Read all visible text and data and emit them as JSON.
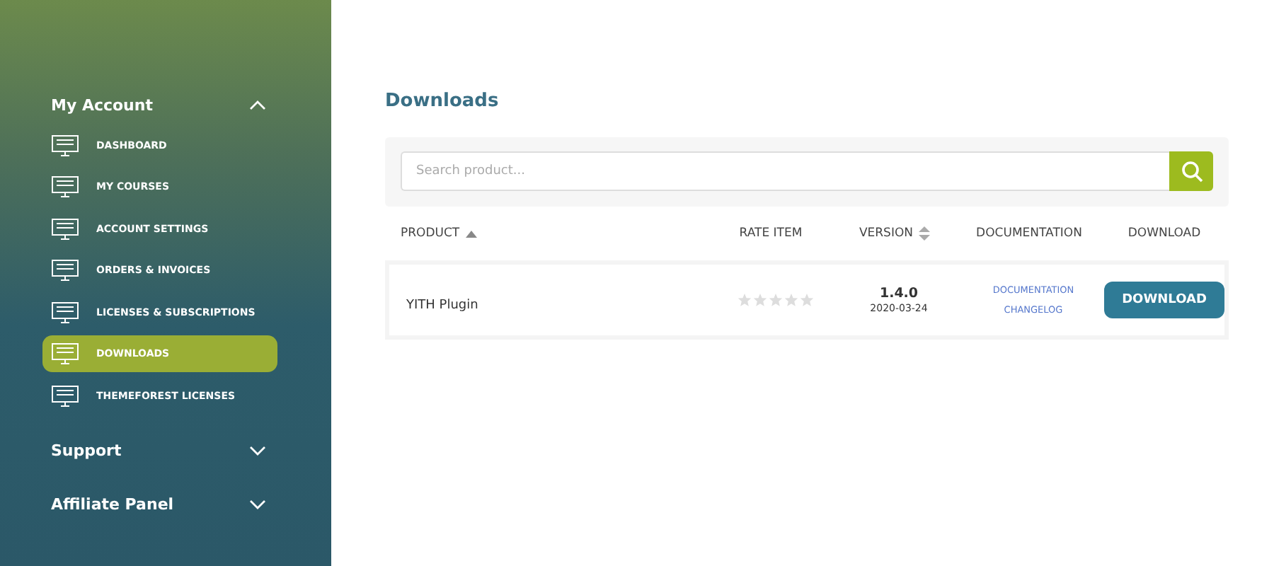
{
  "sidebar": {
    "sections": [
      {
        "title": "My Account",
        "expanded": true,
        "items": [
          {
            "label": "DASHBOARD",
            "selected": false
          },
          {
            "label": "MY COURSES",
            "selected": false
          },
          {
            "label": "ACCOUNT SETTINGS",
            "selected": false
          },
          {
            "label": "ORDERS & INVOICES",
            "selected": false
          },
          {
            "label": "LICENSES & SUBSCRIPTIONS",
            "selected": false
          },
          {
            "label": "DOWNLOADS",
            "selected": true
          },
          {
            "label": "THEMEFOREST LICENSES",
            "selected": false
          }
        ]
      },
      {
        "title": "Support",
        "expanded": false
      },
      {
        "title": "Affiliate Panel",
        "expanded": false
      }
    ]
  },
  "main": {
    "title": "Downloads",
    "search": {
      "placeholder": "Search product..."
    },
    "table": {
      "columns": [
        {
          "label": "PRODUCT",
          "sortable": true,
          "sorted": true
        },
        {
          "label": "RATE ITEM"
        },
        {
          "label": "VERSION",
          "sortable": true,
          "sorted": false
        },
        {
          "label": "DOCUMENTATION"
        },
        {
          "label": "DOWNLOAD"
        }
      ],
      "rows": [
        {
          "product": "YITH Plugin",
          "stars": 0,
          "version": "1.4.0",
          "date": "2020-03-24",
          "links": [
            "DOCUMENTATION",
            "CHANGELOG"
          ],
          "button": "DOWNLOAD"
        }
      ]
    }
  }
}
